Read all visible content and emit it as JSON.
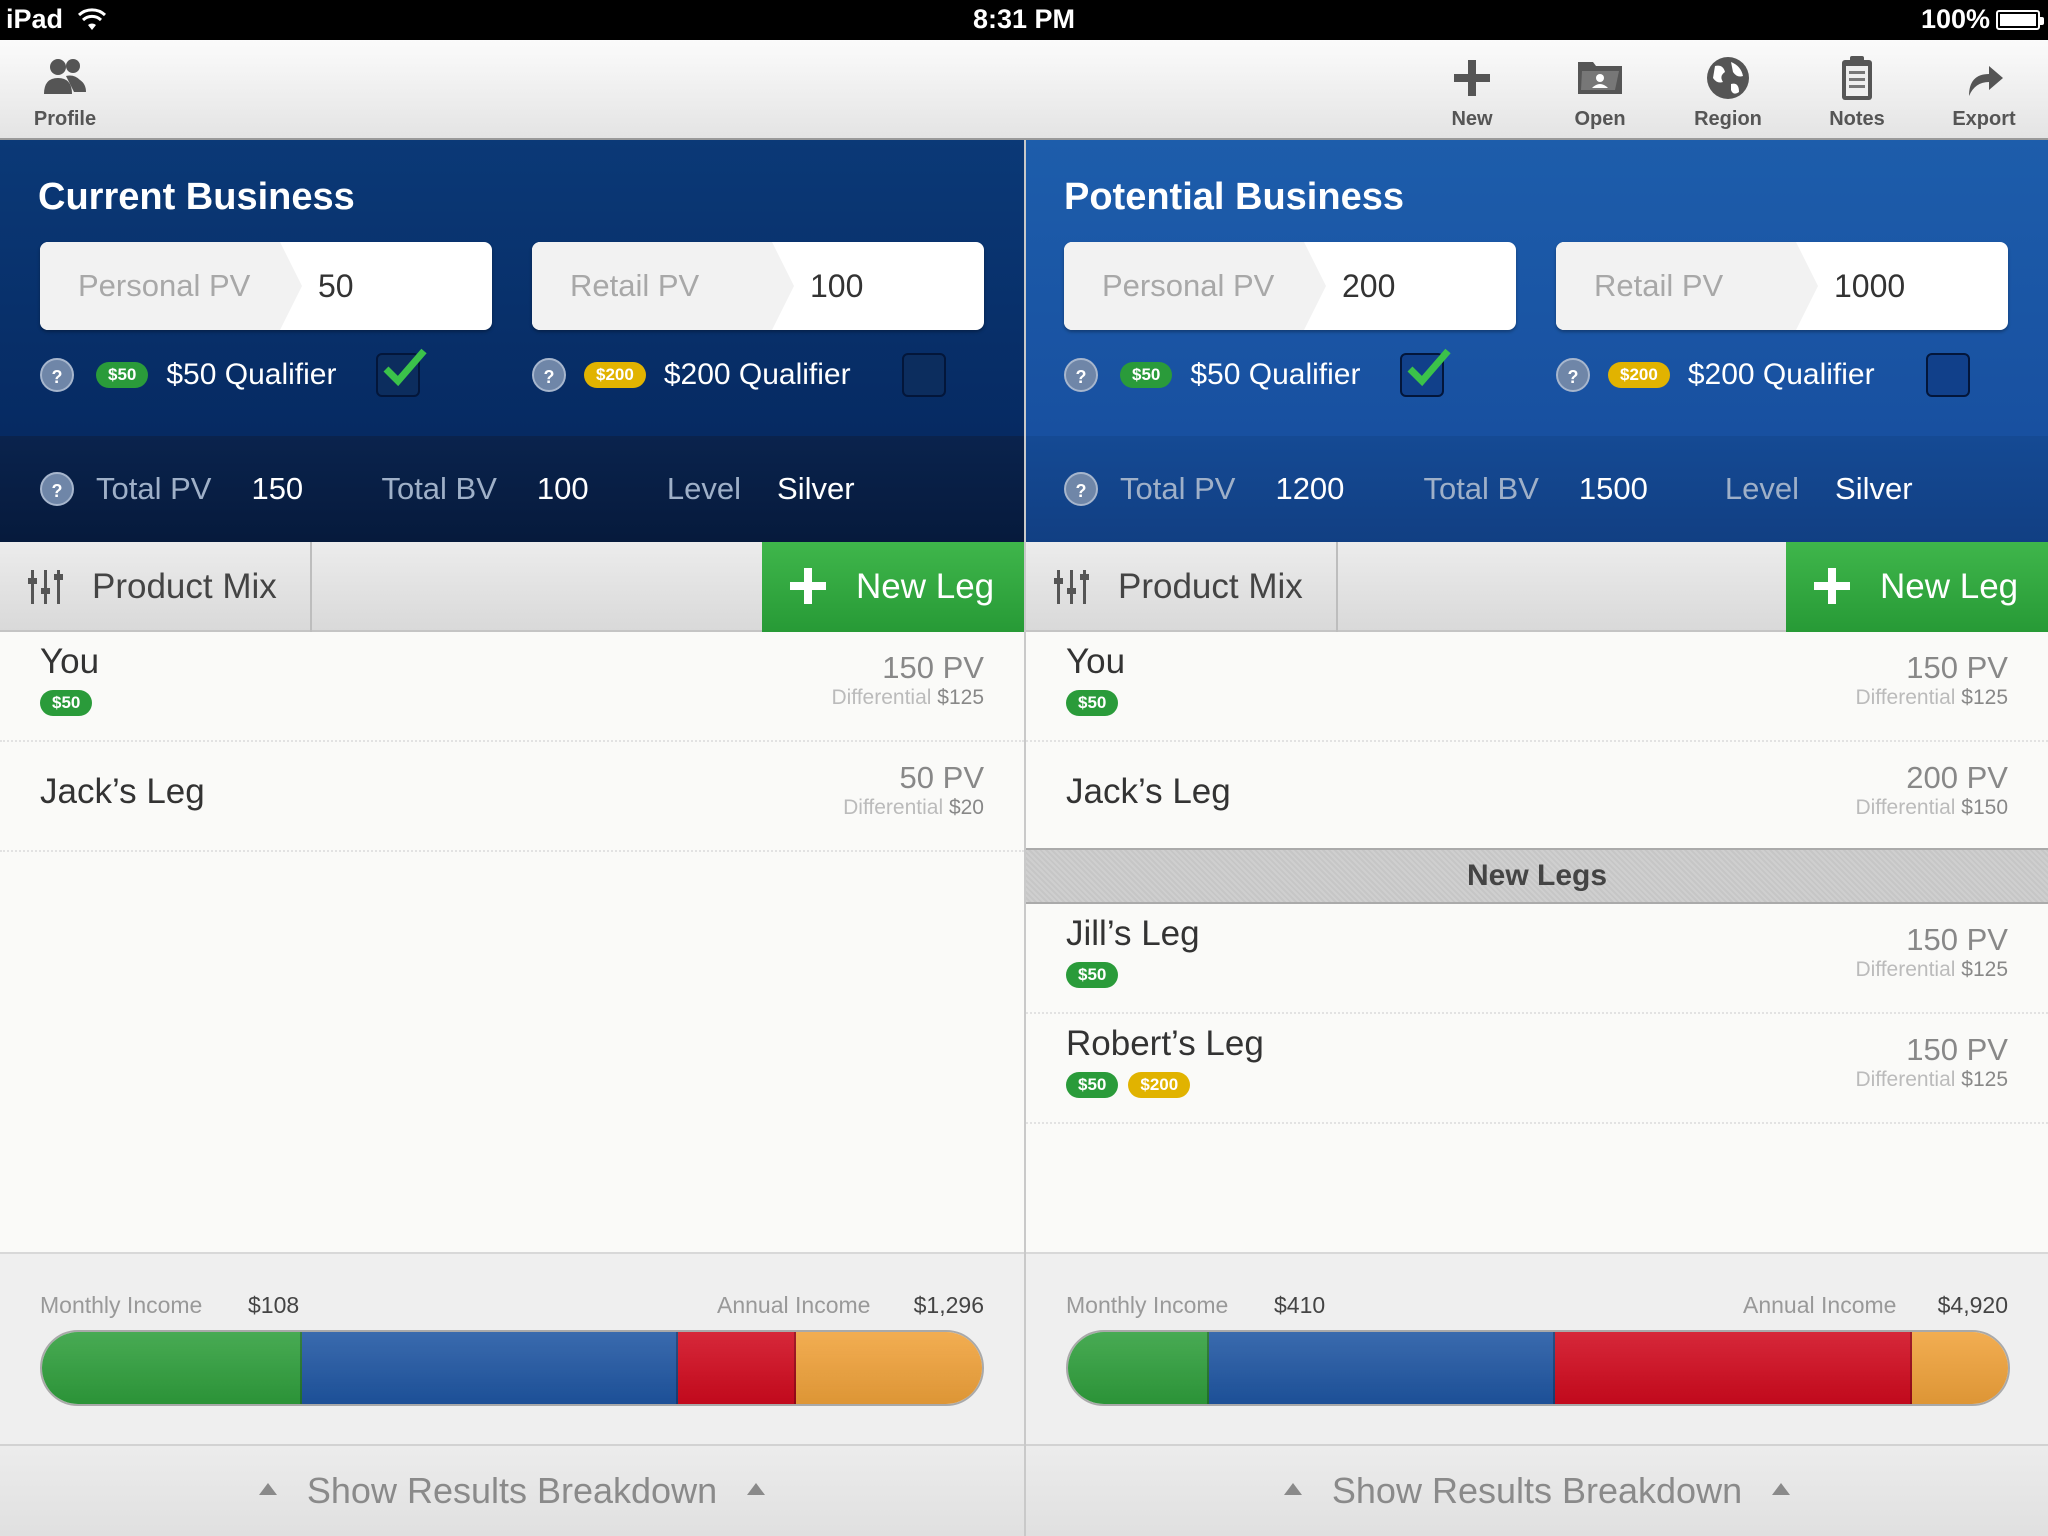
{
  "status": {
    "device": "iPad",
    "time": "8:31 PM",
    "battery": "100%"
  },
  "toolbar": {
    "profile": "Profile",
    "new": "New",
    "open": "Open",
    "region": "Region",
    "notes": "Notes",
    "export": "Export"
  },
  "current": {
    "title": "Current Business",
    "personal_pv_label": "Personal PV",
    "personal_pv": "50",
    "retail_pv_label": "Retail PV",
    "retail_pv": "100",
    "q50_badge": "$50",
    "q50_label": "$50 Qualifier",
    "q50_checked": true,
    "q200_badge": "$200",
    "q200_label": "$200 Qualifier",
    "q200_checked": false,
    "help": "?",
    "total_pv_label": "Total PV",
    "total_pv": "150",
    "total_bv_label": "Total BV",
    "total_bv": "100",
    "level_label": "Level",
    "level": "Silver",
    "product_mix": "Product Mix",
    "new_leg": "New Leg",
    "legs": [
      {
        "name": "You",
        "badges": [
          "$50"
        ],
        "pv": "150 PV",
        "diff_label": "Differential",
        "diff": "$125"
      },
      {
        "name": "Jack’s Leg",
        "badges": [],
        "pv": "50 PV",
        "diff_label": "Differential",
        "diff": "$20"
      }
    ],
    "monthly_label": "Monthly Income",
    "monthly": "$108",
    "annual_label": "Annual Income",
    "annual": "$1,296",
    "breakdown_fractions": [
      0.277,
      0.4,
      0.125,
      0.198
    ],
    "show_results": "Show Results Breakdown"
  },
  "potential": {
    "title": "Potential Business",
    "personal_pv_label": "Personal PV",
    "personal_pv": "200",
    "retail_pv_label": "Retail PV",
    "retail_pv": "1000",
    "q50_badge": "$50",
    "q50_label": "$50 Qualifier",
    "q50_checked": true,
    "q200_badge": "$200",
    "q200_label": "$200 Qualifier",
    "q200_checked": false,
    "help": "?",
    "total_pv_label": "Total PV",
    "total_pv": "1200",
    "total_bv_label": "Total BV",
    "total_bv": "1500",
    "level_label": "Level",
    "level": "Silver",
    "product_mix": "Product Mix",
    "new_leg": "New Leg",
    "legs": [
      {
        "name": "You",
        "badges": [
          "$50"
        ],
        "pv": "150 PV",
        "diff_label": "Differential",
        "diff": "$125"
      },
      {
        "name": "Jack’s Leg",
        "badges": [],
        "pv": "200 PV",
        "diff_label": "Differential",
        "diff": "$150"
      }
    ],
    "new_legs_header": "New Legs",
    "new_legs": [
      {
        "name": "Jill’s Leg",
        "badges": [
          "$50"
        ],
        "pv": "150 PV",
        "diff_label": "Differential",
        "diff": "$125"
      },
      {
        "name": "Robert’s Leg",
        "badges": [
          "$50",
          "$200"
        ],
        "pv": "150 PV",
        "diff_label": "Differential",
        "diff": "$125"
      }
    ],
    "monthly_label": "Monthly Income",
    "monthly": "$410",
    "annual_label": "Annual Income",
    "annual": "$4,920",
    "breakdown_fractions": [
      0.15,
      0.368,
      0.38,
      0.102
    ],
    "show_results": "Show Results Breakdown"
  },
  "colors": {
    "green": "#2f9f3c",
    "blue": "#1f56a3",
    "red": "#d10a1e",
    "orange": "#f0a23a"
  }
}
